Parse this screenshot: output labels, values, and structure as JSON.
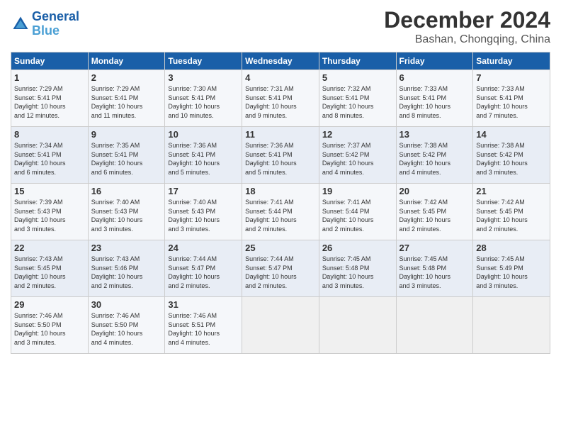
{
  "logo": {
    "line1": "General",
    "line2": "Blue"
  },
  "title": "December 2024",
  "location": "Bashan, Chongqing, China",
  "days_of_week": [
    "Sunday",
    "Monday",
    "Tuesday",
    "Wednesday",
    "Thursday",
    "Friday",
    "Saturday"
  ],
  "weeks": [
    [
      {
        "day": "1",
        "info": "Sunrise: 7:29 AM\nSunset: 5:41 PM\nDaylight: 10 hours\nand 12 minutes."
      },
      {
        "day": "2",
        "info": "Sunrise: 7:29 AM\nSunset: 5:41 PM\nDaylight: 10 hours\nand 11 minutes."
      },
      {
        "day": "3",
        "info": "Sunrise: 7:30 AM\nSunset: 5:41 PM\nDaylight: 10 hours\nand 10 minutes."
      },
      {
        "day": "4",
        "info": "Sunrise: 7:31 AM\nSunset: 5:41 PM\nDaylight: 10 hours\nand 9 minutes."
      },
      {
        "day": "5",
        "info": "Sunrise: 7:32 AM\nSunset: 5:41 PM\nDaylight: 10 hours\nand 8 minutes."
      },
      {
        "day": "6",
        "info": "Sunrise: 7:33 AM\nSunset: 5:41 PM\nDaylight: 10 hours\nand 8 minutes."
      },
      {
        "day": "7",
        "info": "Sunrise: 7:33 AM\nSunset: 5:41 PM\nDaylight: 10 hours\nand 7 minutes."
      }
    ],
    [
      {
        "day": "8",
        "info": "Sunrise: 7:34 AM\nSunset: 5:41 PM\nDaylight: 10 hours\nand 6 minutes."
      },
      {
        "day": "9",
        "info": "Sunrise: 7:35 AM\nSunset: 5:41 PM\nDaylight: 10 hours\nand 6 minutes."
      },
      {
        "day": "10",
        "info": "Sunrise: 7:36 AM\nSunset: 5:41 PM\nDaylight: 10 hours\nand 5 minutes."
      },
      {
        "day": "11",
        "info": "Sunrise: 7:36 AM\nSunset: 5:41 PM\nDaylight: 10 hours\nand 5 minutes."
      },
      {
        "day": "12",
        "info": "Sunrise: 7:37 AM\nSunset: 5:42 PM\nDaylight: 10 hours\nand 4 minutes."
      },
      {
        "day": "13",
        "info": "Sunrise: 7:38 AM\nSunset: 5:42 PM\nDaylight: 10 hours\nand 4 minutes."
      },
      {
        "day": "14",
        "info": "Sunrise: 7:38 AM\nSunset: 5:42 PM\nDaylight: 10 hours\nand 3 minutes."
      }
    ],
    [
      {
        "day": "15",
        "info": "Sunrise: 7:39 AM\nSunset: 5:43 PM\nDaylight: 10 hours\nand 3 minutes."
      },
      {
        "day": "16",
        "info": "Sunrise: 7:40 AM\nSunset: 5:43 PM\nDaylight: 10 hours\nand 3 minutes."
      },
      {
        "day": "17",
        "info": "Sunrise: 7:40 AM\nSunset: 5:43 PM\nDaylight: 10 hours\nand 3 minutes."
      },
      {
        "day": "18",
        "info": "Sunrise: 7:41 AM\nSunset: 5:44 PM\nDaylight: 10 hours\nand 2 minutes."
      },
      {
        "day": "19",
        "info": "Sunrise: 7:41 AM\nSunset: 5:44 PM\nDaylight: 10 hours\nand 2 minutes."
      },
      {
        "day": "20",
        "info": "Sunrise: 7:42 AM\nSunset: 5:45 PM\nDaylight: 10 hours\nand 2 minutes."
      },
      {
        "day": "21",
        "info": "Sunrise: 7:42 AM\nSunset: 5:45 PM\nDaylight: 10 hours\nand 2 minutes."
      }
    ],
    [
      {
        "day": "22",
        "info": "Sunrise: 7:43 AM\nSunset: 5:45 PM\nDaylight: 10 hours\nand 2 minutes."
      },
      {
        "day": "23",
        "info": "Sunrise: 7:43 AM\nSunset: 5:46 PM\nDaylight: 10 hours\nand 2 minutes."
      },
      {
        "day": "24",
        "info": "Sunrise: 7:44 AM\nSunset: 5:47 PM\nDaylight: 10 hours\nand 2 minutes."
      },
      {
        "day": "25",
        "info": "Sunrise: 7:44 AM\nSunset: 5:47 PM\nDaylight: 10 hours\nand 2 minutes."
      },
      {
        "day": "26",
        "info": "Sunrise: 7:45 AM\nSunset: 5:48 PM\nDaylight: 10 hours\nand 3 minutes."
      },
      {
        "day": "27",
        "info": "Sunrise: 7:45 AM\nSunset: 5:48 PM\nDaylight: 10 hours\nand 3 minutes."
      },
      {
        "day": "28",
        "info": "Sunrise: 7:45 AM\nSunset: 5:49 PM\nDaylight: 10 hours\nand 3 minutes."
      }
    ],
    [
      {
        "day": "29",
        "info": "Sunrise: 7:46 AM\nSunset: 5:50 PM\nDaylight: 10 hours\nand 3 minutes."
      },
      {
        "day": "30",
        "info": "Sunrise: 7:46 AM\nSunset: 5:50 PM\nDaylight: 10 hours\nand 4 minutes."
      },
      {
        "day": "31",
        "info": "Sunrise: 7:46 AM\nSunset: 5:51 PM\nDaylight: 10 hours\nand 4 minutes."
      },
      {
        "day": "",
        "info": ""
      },
      {
        "day": "",
        "info": ""
      },
      {
        "day": "",
        "info": ""
      },
      {
        "day": "",
        "info": ""
      }
    ]
  ]
}
